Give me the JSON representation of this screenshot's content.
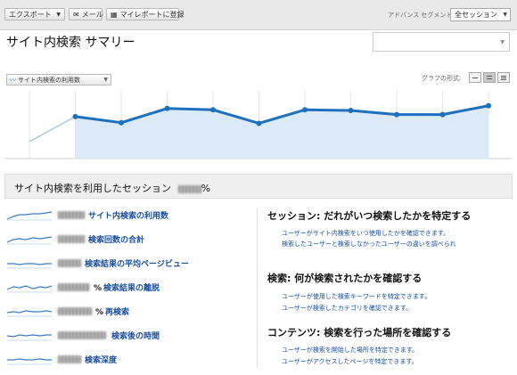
{
  "toolbar": {
    "export_label": "エクスポート",
    "email_label": "メール",
    "dashboard_label": "マイレポートに登録",
    "advanced_segment_label": "アドバンス セグメント:",
    "segment_value": "全セッション"
  },
  "page": {
    "title": "サイト内検索 サマリー"
  },
  "graph": {
    "metric_tab_label": "サイト内検索の利用数",
    "format_label": "グラフの形式:",
    "values": [
      0.25,
      0.62,
      0.53,
      0.74,
      0.72,
      0.52,
      0.72,
      0.71,
      0.65,
      0.65,
      0.78
    ],
    "line_color": "#1f6fbf",
    "fill_color": "#dbeaf6"
  },
  "section": {
    "title": "サイト内検索を利用したセッション",
    "percent_sign": "%"
  },
  "metrics": [
    {
      "label": "サイト内検索の利用数",
      "suffix": ""
    },
    {
      "label": "検索回数の合計",
      "suffix": ""
    },
    {
      "label": "検索結果の平均ページビュー",
      "suffix": ""
    },
    {
      "label": "検索結果の離脱",
      "suffix": "%"
    },
    {
      "label": "再検索",
      "suffix": "%"
    },
    {
      "label": "検索後の時間",
      "suffix": ""
    },
    {
      "label": "検索深度",
      "suffix": ""
    }
  ],
  "right": {
    "section1": {
      "heading": "セッション: だれがいつ検索したかを特定する",
      "line1": "ユーザーがサイト内検索をいつ使用したかを確認できます。",
      "line2": "検索したユーザーと検索しなかったユーザーの違いを調べられ"
    },
    "section2": {
      "heading": "検索: 何が検索されたかを確認する",
      "line1": "ユーザーが使用した検索キーワードを特定できます。",
      "line2": "ユーザーが検索したカテゴリを確認できます。"
    },
    "section3": {
      "heading": "コンテンツ: 検索を行った場所を確認する",
      "line1": "ユーザーが検索を開始した場所を特定できます。",
      "line2": "ユーザーがアクセスしたページを特定できます。"
    }
  }
}
